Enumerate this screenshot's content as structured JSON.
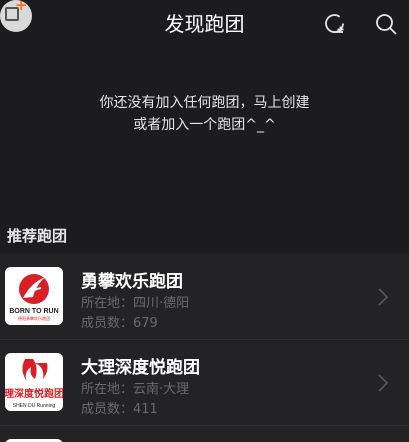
{
  "header": {
    "title": "发现跑团",
    "create_icon": "add-comment-icon",
    "search_icon": "search-icon"
  },
  "empty_state": {
    "line1": "你还没有加入任何跑团，马上创建",
    "line2": "或者加入一个跑团^_^"
  },
  "recommended": {
    "section_title": "推荐跑团",
    "clubs": [
      {
        "name": "勇攀欢乐跑团",
        "location": "所在地：四川·德阳",
        "members": "成员数：679",
        "logo_text": "BORN TO RUN",
        "logo_subtext": "德阳勇攀欢乐跑团",
        "accent": "#d81e26"
      },
      {
        "name": "大理深度悦跑团",
        "location": "所在地：云南·大理",
        "members": "成员数：411",
        "logo_text": "理深度悦跑团",
        "logo_subtext": "SHEN DU Running",
        "accent": "#d81e26"
      }
    ]
  },
  "colors": {
    "background": "#1c1c1e",
    "row": "#232325",
    "badge_plus": "#ff6a1f",
    "secondary_text": "#6b6b6e"
  }
}
